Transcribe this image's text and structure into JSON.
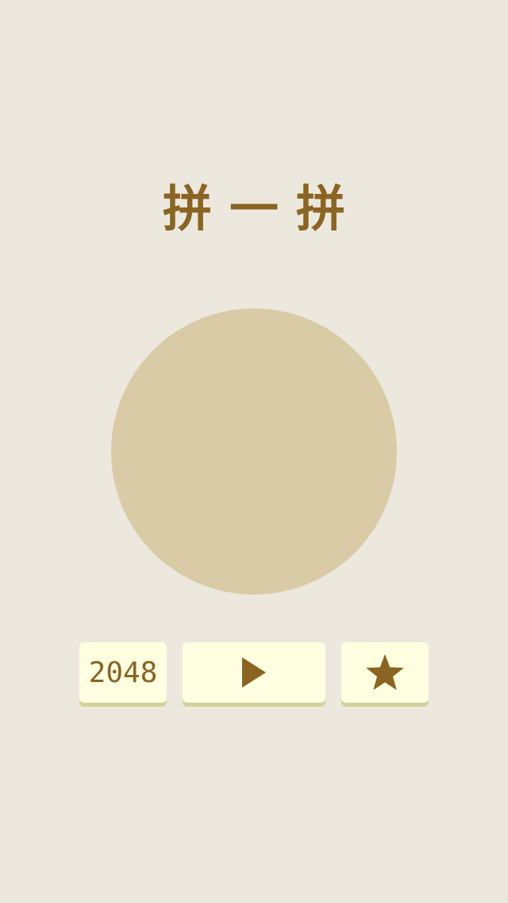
{
  "app": {
    "title": "拼一拼"
  },
  "menu": {
    "mode_2048_label": "2048",
    "play_icon": "play-icon",
    "favorites_icon": "star-icon"
  },
  "colors": {
    "background": "#ede8de",
    "title": "#8a6422",
    "disc": "#d9cba6",
    "button_face": "#fffee0",
    "button_shadow": "#d4d09a",
    "icon": "#8a6422"
  }
}
